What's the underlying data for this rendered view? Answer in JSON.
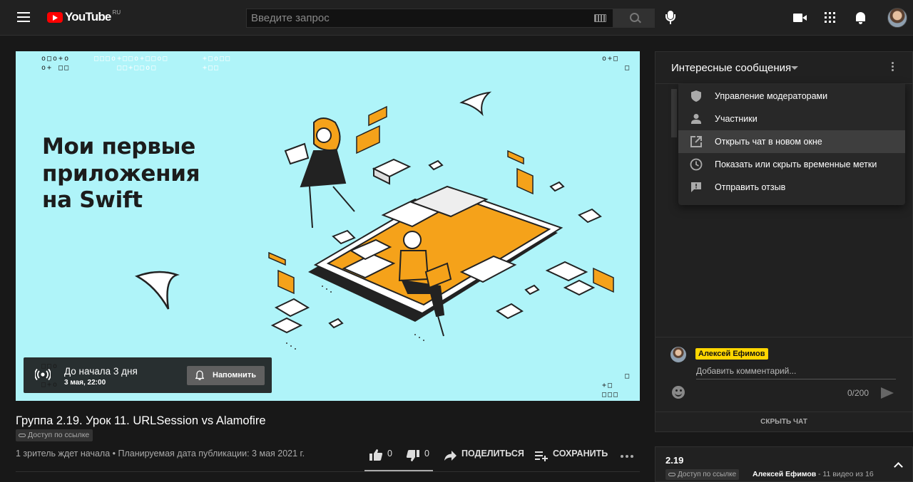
{
  "header": {
    "logo_text": "YouTube",
    "logo_region": "RU",
    "search_placeholder": "Введите запрос"
  },
  "video": {
    "thumbnail_title_lines": [
      "Мои первые",
      "приложения",
      "на Swift"
    ],
    "countdown_main": "До начала 3 дня",
    "countdown_sub": "3 мая, 22:00",
    "remind_label": "Напомнить",
    "title": "Группа 2.19. Урок 11. URLSession vs Alamofire",
    "privacy": "Доступ по ссылке",
    "meta": "1 зритель ждет начала • Планируемая дата публикации: 3 мая 2021 г.",
    "likes": "0",
    "dislikes": "0",
    "share_label": "ПОДЕЛИТЬСЯ",
    "save_label": "СОХРАНИТЬ"
  },
  "chat": {
    "title": "Интересные сообщения",
    "menu": [
      {
        "label": "Управление модераторами",
        "icon": "shield-icon"
      },
      {
        "label": "Участники",
        "icon": "person-icon"
      },
      {
        "label": "Открыть чат в новом окне",
        "icon": "open-in-new-icon",
        "highlighted": true
      },
      {
        "label": "Показать или скрыть временные метки",
        "icon": "clock-icon"
      },
      {
        "label": "Отправить отзыв",
        "icon": "feedback-icon"
      }
    ],
    "author": "Алексей Ефимов",
    "input_placeholder": "Добавить комментарий...",
    "char_count": "0/200",
    "hide_label": "СКРЫТЬ ЧАТ"
  },
  "playlist": {
    "title": "2.19",
    "privacy": "Доступ по ссылке",
    "owner": "Алексей Ефимов",
    "count": "- 11 видео из 16"
  },
  "colors": {
    "accent_orange": "#f5a21a",
    "thumb_bg": "#aff4f9",
    "author_chip": "#ffd600",
    "youtube_red": "#ff0000"
  }
}
